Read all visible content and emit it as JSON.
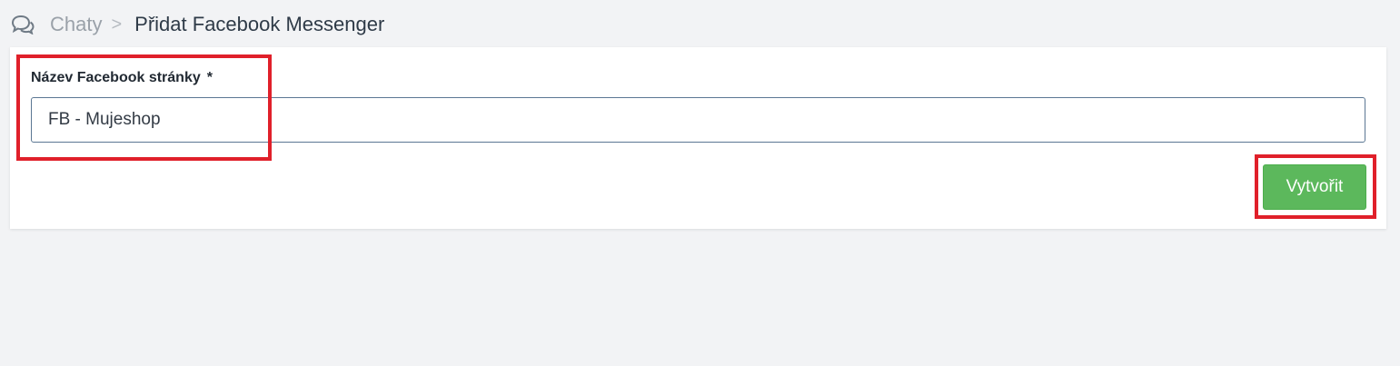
{
  "breadcrumb": {
    "icon": "chat-bubbles-icon",
    "parent_label": "Chaty",
    "separator": ">",
    "current_label": "Přidat Facebook Messenger"
  },
  "form": {
    "field_label": "Název Facebook stránky",
    "required_marker": "*",
    "field_value": "FB - Mujeshop",
    "submit_label": "Vytvořit"
  },
  "colors": {
    "background": "#f2f3f5",
    "panel": "#ffffff",
    "submit_button": "#5cb85c",
    "annotation_highlight": "#e0202a",
    "input_border": "#5b7793"
  }
}
